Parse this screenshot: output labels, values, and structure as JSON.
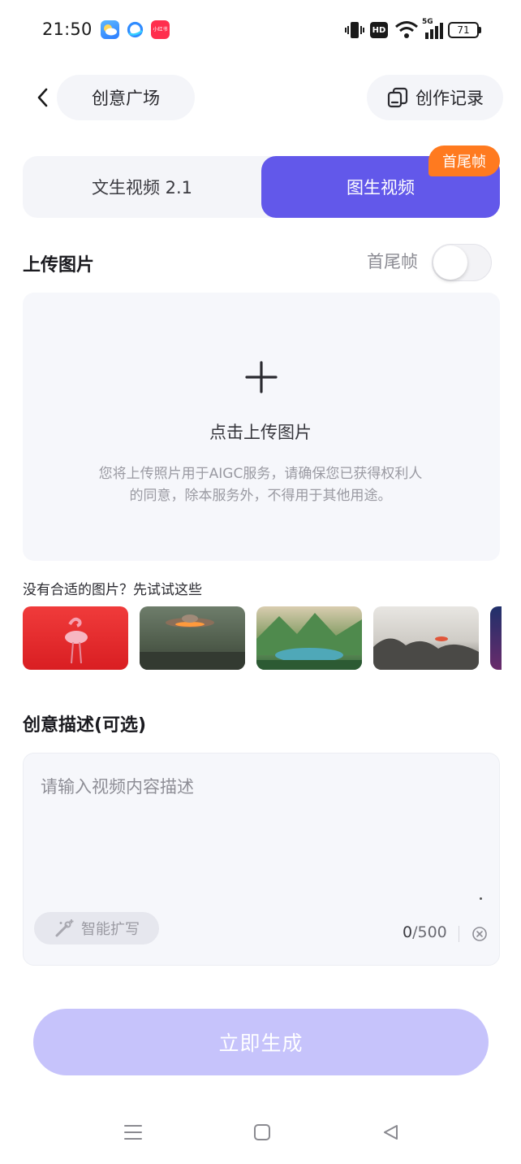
{
  "status_bar": {
    "time": "21:50",
    "battery": "71",
    "network": "5G",
    "hd": "HD",
    "app_icons": [
      "weather-app-icon",
      "qq-browser-icon",
      "xiaohongshu-icon"
    ],
    "xiaohongshu_text": "小红书"
  },
  "header": {
    "back_icon": "chevron-left-icon",
    "title": "创意广场",
    "records_label": "创作记录",
    "records_icon": "copy-records-icon"
  },
  "tabs": {
    "items": [
      {
        "label": "文生视频 2.1",
        "active": false
      },
      {
        "label": "图生视频",
        "active": true
      }
    ],
    "badge": "首尾帧",
    "active_color": "#6258ea",
    "badge_color": "#ff7a1f"
  },
  "upload": {
    "title": "上传图片",
    "toggle_label": "首尾帧",
    "toggle_on": false,
    "plus_icon": "plus-icon",
    "prompt": "点击上传图片",
    "note_line1": "您将上传照片用于AIGC服务，请确保您已获得权利人",
    "note_line2": "的同意，除本服务外，不得用于其他用途。"
  },
  "suggestions": {
    "label": "没有合适的图片？先试试这些",
    "thumbnails": [
      "flamingo-image",
      "ufo-image",
      "mountain-lake-image",
      "ink-painting-image",
      "more-image"
    ]
  },
  "description": {
    "title": "创意描述(可选)",
    "placeholder": "请输入视频内容描述",
    "smart_expand_label": "智能扩写",
    "smart_icon": "magic-wand-icon",
    "count_current": "0",
    "count_max": "/500",
    "clear_icon": "clear-circle-icon"
  },
  "action": {
    "generate_label": "立即生成",
    "button_color": "#c6c3fb"
  },
  "nav_bar": {
    "icons": [
      "menu-icon",
      "home-square-icon",
      "back-triangle-icon"
    ]
  }
}
